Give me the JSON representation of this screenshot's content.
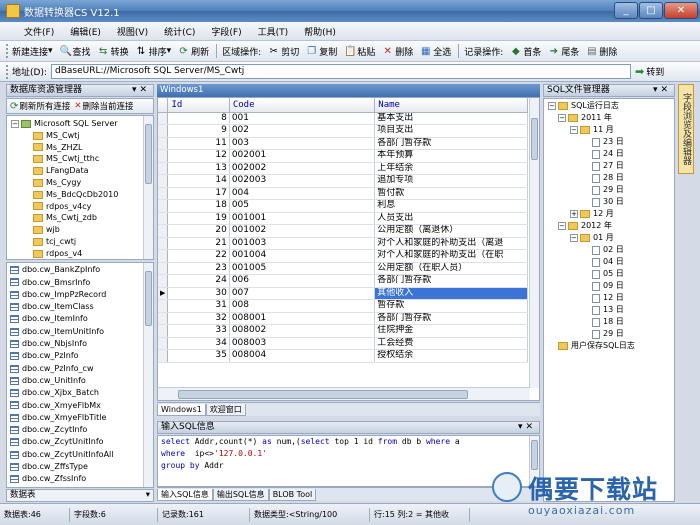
{
  "window": {
    "title": "数据转换器CS V12.1"
  },
  "menu": [
    "文件(F)",
    "编辑(E)",
    "视图(V)",
    "统计(C)",
    "字段(F)",
    "工具(T)",
    "帮助(H)"
  ],
  "toolbar": {
    "new_conn": "新建连接",
    "find": "查找",
    "convert": "转换",
    "sort": "排序",
    "refresh": "刷新",
    "region_label": "区域操作:",
    "cut": "剪切",
    "copy": "复制",
    "paste": "粘贴",
    "delete": "删除",
    "select_all": "全选",
    "record_label": "记录操作:",
    "first": "首条",
    "last": "尾条",
    "delete_record": "删除"
  },
  "address": {
    "label": "地址(D):",
    "value": "dBaseURL://Microsoft SQL Server/MS_Cwtj",
    "go": "转到"
  },
  "left_panel": {
    "title": "数据库资源管理器",
    "refresh_all": "刷新所有连接",
    "delete_conn": "删除当前连接",
    "root": "Microsoft SQL Server",
    "databases": [
      "MS_Cwtj",
      "Ms_ZHZL",
      "MS_Cwtj_tthc",
      "LFangData",
      "Ms_Cygy",
      "Ms_BdcQcDb2010",
      "rdpos_v4cy",
      "Ms_Cwtj_zdb",
      "wjb",
      "tcj_cwtj",
      "rdpos_v4",
      "Ms_Cwtj"
    ],
    "tables": [
      "dbo.cw_BankZpInfo",
      "dbo.cw_BmsrInfo",
      "dbo.cw_ImpPzRecord",
      "dbo.cw_ItemClass",
      "dbo.cw_ItemInfo",
      "dbo.cw_ItemUnitInfo",
      "dbo.cw_NbjsInfo",
      "dbo.cw_PzInfo",
      "dbo.cw_PzInfo_cw",
      "dbo.cw_UnitInfo",
      "dbo.cw_Xjbx_Batch",
      "dbo.cw_XmyeFlbMx",
      "dbo.cw_XmyeFlbTitle",
      "dbo.cw_ZcytInfo",
      "dbo.cw_ZcytUnitInfo",
      "dbo.cw_ZcytUnitInfoAll",
      "dbo.cw_ZffsType",
      "dbo.cw_ZfssInfo"
    ],
    "footer": "数据表"
  },
  "grid": {
    "window_title": "Windows1",
    "columns": [
      "Id",
      "Code",
      "Name"
    ],
    "rows": [
      [
        "8",
        "001",
        "基本支出"
      ],
      [
        "9",
        "002",
        "项目支出"
      ],
      [
        "11",
        "003",
        "各部门暂存款"
      ],
      [
        "12",
        "002001",
        "本年预算"
      ],
      [
        "13",
        "002002",
        "上年结余"
      ],
      [
        "14",
        "002003",
        "追加专项"
      ],
      [
        "17",
        "004",
        "暂付款"
      ],
      [
        "18",
        "005",
        "利息"
      ],
      [
        "19",
        "001001",
        "人员支出"
      ],
      [
        "20",
        "001002",
        "公用定额（离退休）"
      ],
      [
        "21",
        "001003",
        "对个人和家庭的补助支出（离退"
      ],
      [
        "22",
        "001004",
        "对个人和家庭的补助支出（在职"
      ],
      [
        "23",
        "001005",
        "公用定额（在职人员）"
      ],
      [
        "24",
        "006",
        "各部门暂存款"
      ],
      [
        "30",
        "007",
        "其他收入"
      ],
      [
        "31",
        "008",
        "暂存款"
      ],
      [
        "32",
        "008001",
        "各部门暂存款"
      ],
      [
        "33",
        "008002",
        "住院押金"
      ],
      [
        "34",
        "008003",
        "工会经费"
      ],
      [
        "35",
        "008004",
        "授权结余"
      ]
    ],
    "selected_row": 14,
    "tabs": [
      "Windows1",
      "欢迎窗口"
    ]
  },
  "sql": {
    "title": "输入SQL信息",
    "line1": [
      "select",
      " Addr,",
      "count",
      "(*) ",
      "as",
      " num,(",
      "select",
      " top 1 id ",
      "from",
      " db b ",
      "where",
      " a"
    ],
    "line2": [
      "where",
      "  ip<>",
      "'127.0.0.1'"
    ],
    "line3": [
      "group by",
      " Addr"
    ],
    "tabs": [
      "输入SQL信息",
      "输出SQL信息",
      "BLOB Tool"
    ]
  },
  "right_panel": {
    "title": "SQL文件管理器",
    "log_root": "SQL运行日志",
    "year1": "2011 年",
    "month1": "11 月",
    "days1": [
      "23 日",
      "24 日",
      "27 日",
      "28 日",
      "29 日",
      "30 日"
    ],
    "month2": "12 月",
    "year2": "2012 年",
    "month3": "01 月",
    "days3": [
      "02 日",
      "04 日",
      "05 日",
      "09 日",
      "12 日",
      "13 日",
      "18 日",
      "29 日"
    ],
    "user_log": "用户保存SQL日志"
  },
  "side_tab": "字段浏览及编辑器",
  "status": {
    "tables": "数据表:46",
    "fields": "字段数:6",
    "records": "记录数:161",
    "type": "数据类型:<String/100",
    "cursor": "行:15 列:2 = 其他收"
  },
  "watermark": {
    "text": "偶要下载站",
    "url": "ouyaoxiazai.com"
  },
  "colors": {
    "accent": "#3c6aa4",
    "selection": "#3b73d6",
    "keyword": "#0000c8",
    "string": "#c00000"
  }
}
